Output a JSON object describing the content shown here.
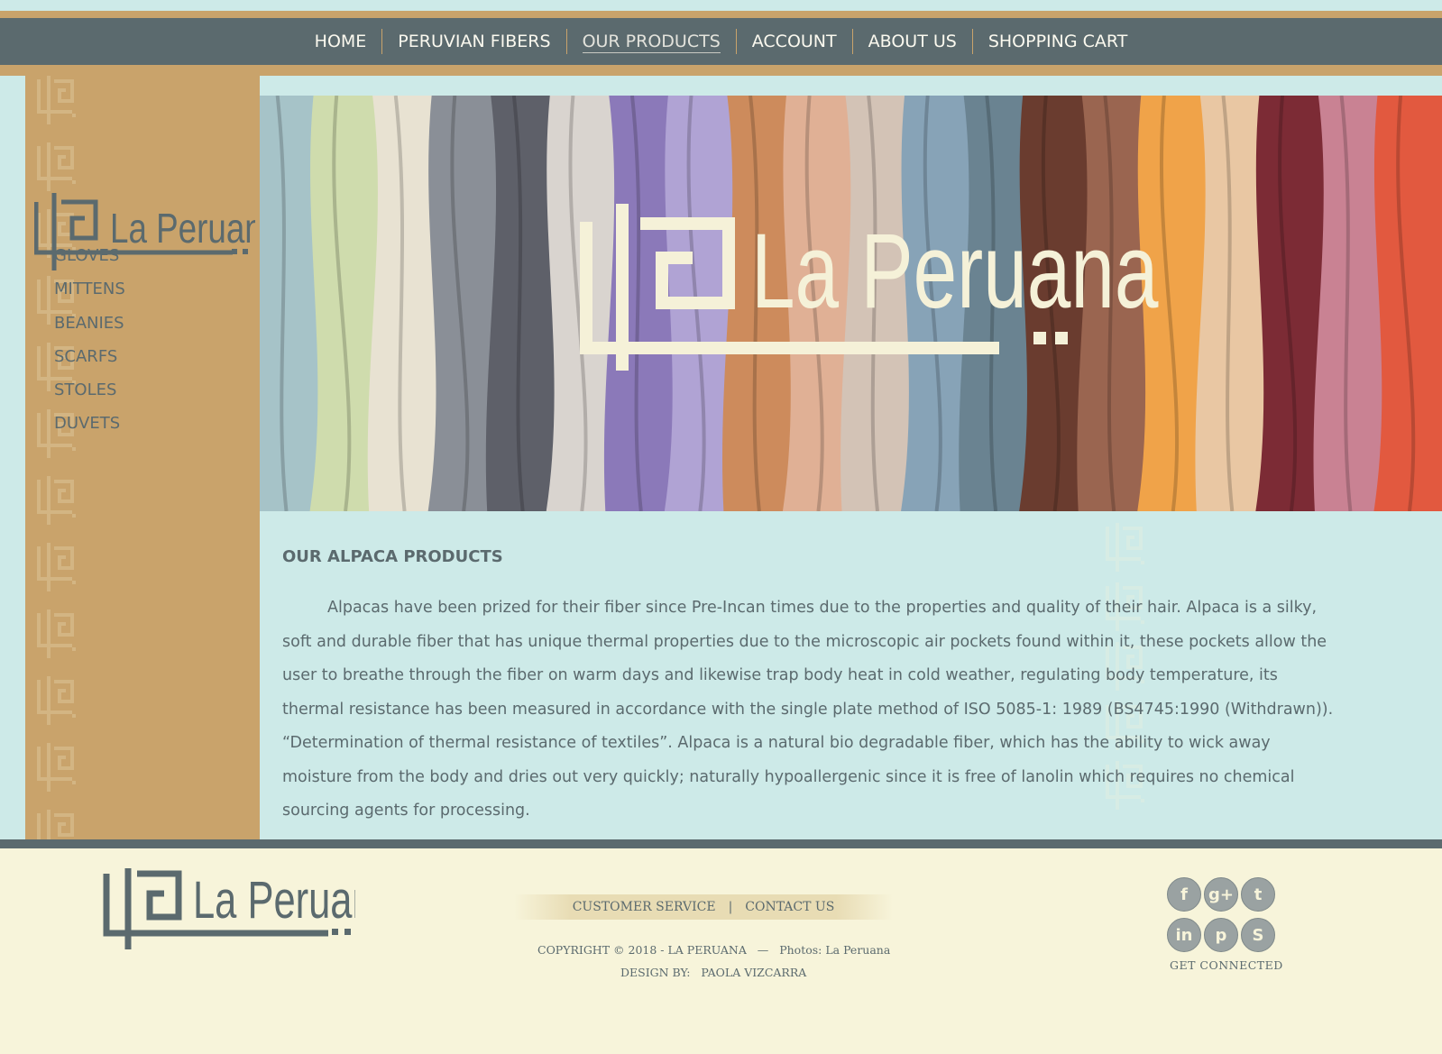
{
  "nav": {
    "items": [
      {
        "label": "HOME"
      },
      {
        "label": "PERUVIAN FIBERS"
      },
      {
        "label": "OUR PRODUCTS",
        "active": true
      },
      {
        "label": "ACCOUNT"
      },
      {
        "label": "ABOUT US"
      },
      {
        "label": "SHOPPING CART"
      }
    ]
  },
  "brand": {
    "logo_text": "La Peruana",
    "colors": {
      "slate": "#5b6a6e",
      "tan": "#c9a36b",
      "mint": "#cdeae8",
      "cream": "#f7f4da"
    }
  },
  "sidebar": {
    "items": [
      {
        "label": "GLOVES"
      },
      {
        "label": "MITTENS"
      },
      {
        "label": "BEANIES"
      },
      {
        "label": "SCARFS"
      },
      {
        "label": "STOLES"
      },
      {
        "label": "DUVETS"
      }
    ]
  },
  "hero": {
    "logo_text": "La Peruana",
    "image_subject": "hanging alpaca scarves in assorted colors",
    "scarf_colors": [
      "#a6c3c8",
      "#cfdcad",
      "#e8e2d2",
      "#8a8f97",
      "#5e6069",
      "#d9d4cf",
      "#8b79b9",
      "#b0a3d4",
      "#cd8b5c",
      "#e0b095",
      "#d3c3b6",
      "#87a3b7",
      "#6a8391",
      "#6a3c2f",
      "#9a6550",
      "#f0a349",
      "#e9c7a3",
      "#7c2b35",
      "#c98293",
      "#e2593f"
    ]
  },
  "content": {
    "title": "OUR ALPACA PRODUCTS",
    "body": "Alpacas have been prized for their fiber since Pre-Incan times due to the properties and quality of their hair. Alpaca is a silky, soft and durable fiber that has unique thermal properties due to the microscopic air pockets found within it, these pockets allow the user to breathe through the fiber on warm days and likewise trap body heat in cold weather, regulating body temperature, its thermal resistance has been measured in accordance with the single plate method of ISO 5085-1: 1989 (BS4745:1990 (Withdrawn)). “Determination of thermal resistance of textiles”. Alpaca is a natural bio degradable fiber, which has the ability to wick away moisture from the body and dries out very quickly; naturally hypoallergenic since it is free of lanolin which requires no chemical sourcing agents for processing."
  },
  "footer": {
    "logo_text": "La Peruana",
    "links": [
      {
        "label": "CUSTOMER SERVICE"
      },
      {
        "label": "CONTACT US"
      }
    ],
    "link_separator": "|",
    "copyright": "COPYRIGHT © 2018 - LA PERUANA   —   Photos: La Peruana",
    "design": "DESIGN BY:   PAOLA VIZCARRA",
    "social_label": "GET CONNECTED",
    "social": [
      {
        "name": "facebook-icon",
        "glyph": "f"
      },
      {
        "name": "google-plus-icon",
        "glyph": "g+"
      },
      {
        "name": "twitter-icon",
        "glyph": "t"
      },
      {
        "name": "linkedin-icon",
        "glyph": "in"
      },
      {
        "name": "pinterest-icon",
        "glyph": "p"
      },
      {
        "name": "skype-icon",
        "glyph": "S"
      }
    ]
  }
}
